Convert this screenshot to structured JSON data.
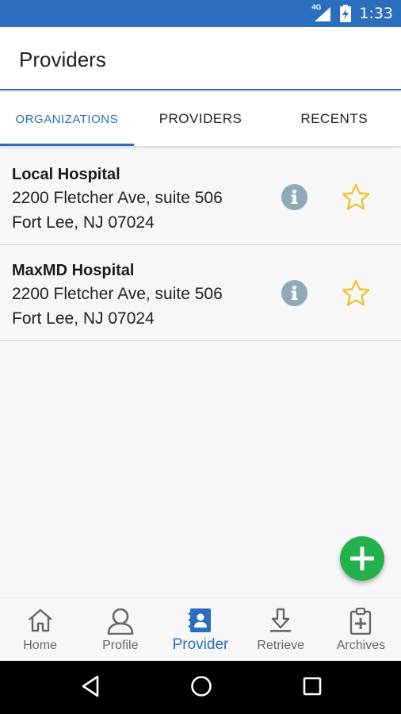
{
  "status_bar": {
    "network": "4G",
    "time": "1:33"
  },
  "app_bar": {
    "title": "Providers"
  },
  "tabs": [
    {
      "label": "ORGANIZATIONS",
      "active": true
    },
    {
      "label": "PROVIDERS",
      "active": false
    },
    {
      "label": "RECENTS",
      "active": false
    }
  ],
  "organizations": [
    {
      "name": "Local Hospital",
      "address_line1": "2200 Fletcher Ave, suite 506",
      "address_line2": "Fort Lee, NJ 07024"
    },
    {
      "name": "MaxMD Hospital",
      "address_line1": "2200 Fletcher Ave, suite 506",
      "address_line2": "Fort Lee, NJ 07024"
    }
  ],
  "fab": {
    "icon": "plus-icon"
  },
  "bottom_nav": [
    {
      "label": "Home",
      "icon": "home-icon",
      "active": false
    },
    {
      "label": "Profile",
      "icon": "person-icon",
      "active": false
    },
    {
      "label": "Provider",
      "icon": "contacts-book-icon",
      "active": true
    },
    {
      "label": "Retrieve",
      "icon": "download-icon",
      "active": false
    },
    {
      "label": "Archives",
      "icon": "clipboard-plus-icon",
      "active": false
    }
  ],
  "colors": {
    "primary": "#2a6ebd",
    "fab": "#22b14c",
    "star": "#f1c232",
    "info": "#8fa9b7"
  }
}
